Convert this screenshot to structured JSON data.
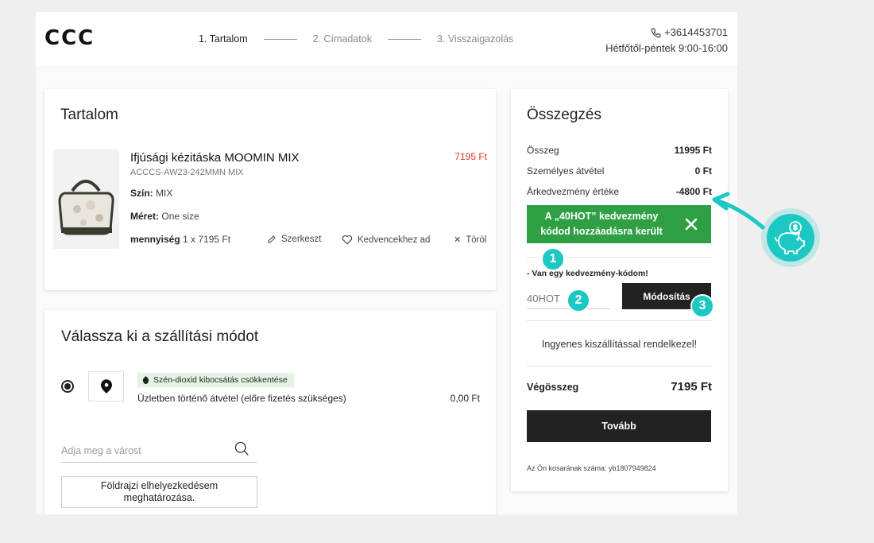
{
  "header": {
    "logo": "CCC",
    "steps": [
      {
        "label": "1. Tartalom"
      },
      {
        "label": "2. Címadatok"
      },
      {
        "label": "3. Visszaigazolás"
      }
    ],
    "phone": "+3614453701",
    "hours": "Hétfőtől-péntek 9:00-16:00"
  },
  "content": {
    "title": "Tartalom",
    "product": {
      "name": "Ifjúsági kézitáska MOOMIN MIX",
      "sku": "ACCCS-AW23-242MMN MIX",
      "price": "7195 Ft",
      "color_label": "Szín:",
      "color_value": "MIX",
      "size_label": "Méret:",
      "size_value": "One size",
      "qty_label": "mennyiség",
      "qty_value": "1 x 7195 Ft"
    },
    "actions": {
      "edit": "Szerkeszt",
      "favorite": "Kedvencekhez ad",
      "delete": "Töröl"
    }
  },
  "shipping": {
    "title": "Válassza ki a szállítási módot",
    "eco_badge": "Szén-dioxid kibocsátás csökkentése",
    "option_label": "Üzletben történő átvétel (előre fizetés szükséges)",
    "option_price": "0,00 Ft",
    "city_placeholder": "Adja meg a várost",
    "geo_button_line1": "Földrajzi elhelyezkedésem",
    "geo_button_line2": "meghatározása."
  },
  "summary": {
    "title": "Összegzés",
    "rows": [
      {
        "label": "Összeg",
        "value": "11995 Ft"
      },
      {
        "label": "Személyes átvétel",
        "value": "0 Ft"
      },
      {
        "label": "Árkedvezmény értéke",
        "value": "-4800 Ft"
      }
    ],
    "promo_line1": "A „40HOT” kedvezmény",
    "promo_line2": "kódod hozzáadásra került",
    "coupon_label": "- Van egy kedvezmény-kódom!",
    "coupon_value": "40HOT",
    "modify_button": "Módosítás",
    "free_shipping": "Ingyenes kiszállítással rendelkezel!",
    "total_label": "Végösszeg",
    "total_value": "7195 Ft",
    "next_button": "Tovább",
    "cart_id": "Az Ön kosarának száma: yb1807949824"
  },
  "annotations": {
    "badges": [
      "1",
      "2",
      "3"
    ],
    "accent_color": "#1cc8c4",
    "promo_color": "#2ea043",
    "icon": "piggy-bank-coin-icon"
  }
}
